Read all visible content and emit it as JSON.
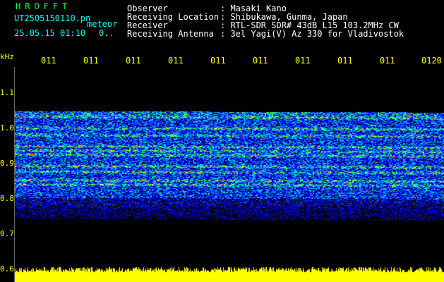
{
  "header": {
    "app_name": "HROFFT",
    "filename": "UT2505150110.pn",
    "mode": "meteor",
    "datetime": "25.05.15 01:10",
    "flag": "0..",
    "fields": [
      {
        "label": "Observer",
        "value": ": Masaki Kano"
      },
      {
        "label": "Receiving Location",
        "value": ": Shibukawa, Gunma, Japan"
      },
      {
        "label": "Receiver",
        "value": ": RTL-SDR SDR# 43dB L15 103.2MHz CW"
      },
      {
        "label": "Receiving Antenna",
        "value": ": 3el Yagi(V) Az 330 for Vladivostok"
      }
    ]
  },
  "axis": {
    "unit": "kHz",
    "y_ticks": [
      "1.1",
      "1.0",
      "0.9",
      "0.8",
      "0.7",
      "0.6"
    ],
    "time_ticks": [
      "011",
      "011",
      "011",
      "011",
      "011",
      "011",
      "011",
      "011",
      "011",
      "0120"
    ]
  },
  "colors": {
    "background": "#000000",
    "header_text": "#ffffff",
    "filename_text": "#00ffff",
    "app_name_text": "#00ff40",
    "axis_text": "#ffff00",
    "signal_bar": "#ffff00"
  }
}
